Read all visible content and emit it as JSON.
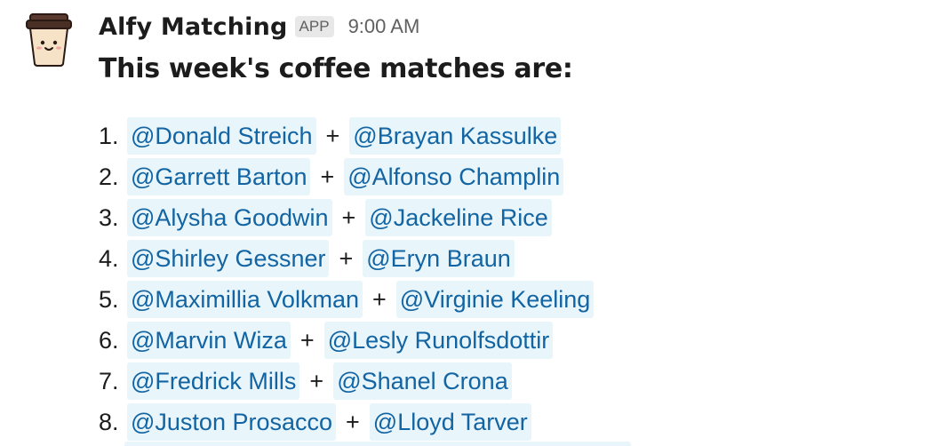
{
  "message": {
    "sender": "Alfy Matching",
    "badge": "APP",
    "timestamp": "9:00 AM",
    "heading": "This week's coffee matches are:"
  },
  "matches": [
    {
      "num": "1.",
      "a": "@Donald Streich",
      "b": "@Brayan Kassulke"
    },
    {
      "num": "2.",
      "a": "@Garrett Barton",
      "b": "@Alfonso Champlin"
    },
    {
      "num": "3.",
      "a": "@Alysha Goodwin",
      "b": "@Jackeline Rice"
    },
    {
      "num": "4.",
      "a": "@Shirley Gessner",
      "b": "@Eryn Braun"
    },
    {
      "num": "5.",
      "a": "@Maximillia Volkman",
      "b": "@Virginie Keeling"
    },
    {
      "num": "6.",
      "a": "@Marvin Wiza",
      "b": "@Lesly Runolfsdottir"
    },
    {
      "num": "7.",
      "a": "@Fredrick Mills",
      "b": "@Shanel Crona"
    },
    {
      "num": "8.",
      "a": "@Juston Prosacco",
      "b": "@Lloyd Tarver"
    }
  ],
  "separator": "+",
  "icons": {
    "avatar": "coffee-cup-icon"
  },
  "colors": {
    "mention_text": "#1264a3",
    "mention_bg": "#e8f5fa",
    "text": "#1d1c1d",
    "muted": "#616061"
  }
}
